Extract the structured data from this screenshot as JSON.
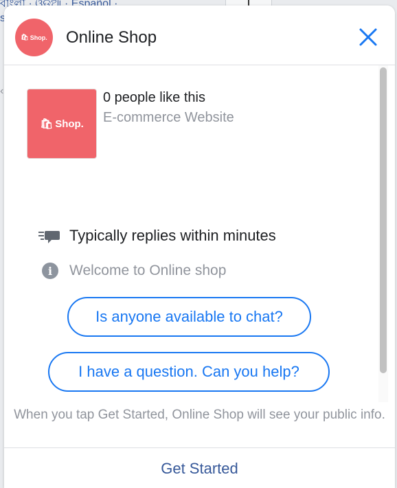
{
  "background": {
    "languages_text": "বাংলা · ଓଡ଼ିଆ · Español ·",
    "partial_text": "s"
  },
  "header": {
    "logo_text": "Shop.",
    "title": "Online Shop",
    "close_icon": "close-icon"
  },
  "page_info": {
    "thumbnail_text": "Shop.",
    "likes": "0 people like this",
    "category": "E-commerce Website"
  },
  "response": {
    "reply_time": "Typically replies within minutes",
    "welcome": "Welcome to Online shop"
  },
  "quick_replies": [
    "Is anyone available to chat?",
    "I have a question. Can you help?"
  ],
  "footer": {
    "note": "When you tap Get Started, Online Shop will see your public info.",
    "button_label": "Get Started"
  },
  "colors": {
    "brand": "#f0646a",
    "accent": "#1877f2",
    "link": "#365899"
  }
}
